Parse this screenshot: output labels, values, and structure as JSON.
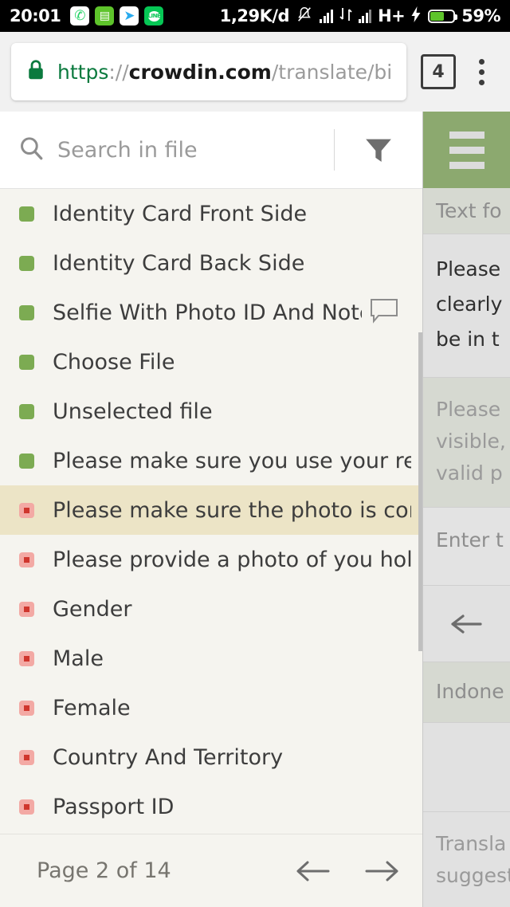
{
  "status_bar": {
    "clock": "20:01",
    "app_icons": [
      {
        "name": "whatsapp-icon",
        "glyph": "✆"
      },
      {
        "name": "battery-app-icon",
        "glyph": "▤"
      },
      {
        "name": "telegram-icon",
        "glyph": "➤"
      },
      {
        "name": "line-icon",
        "glyph": "LINE"
      }
    ],
    "network_speed": "1,29K/d",
    "network_type": "H+",
    "battery_percent": "59%",
    "battery_level": 59,
    "icons": {
      "silent": "bell-slash-icon",
      "signal_1": "signal-bars-icon",
      "data_transfer": "data-transfer-icon",
      "signal_2": "signal-bars-icon",
      "charging": "charging-bolt-icon",
      "battery": "battery-icon"
    }
  },
  "browser": {
    "lock_icon": "lock-icon",
    "url": {
      "scheme": "https",
      "separator": "://",
      "host": "crowdin.com",
      "path": "/translate/bina"
    },
    "tab_count": "4",
    "overflow_menu": "more-vertical-icon"
  },
  "sidebar": {
    "search": {
      "icon": "search-icon",
      "placeholder": "Search in file",
      "value": ""
    },
    "filter_icon": "filter-funnel-icon",
    "strings": [
      {
        "label": "Identity Card Front Side",
        "status": "translated",
        "has_comment": false,
        "selected": false
      },
      {
        "label": "Identity Card Back Side",
        "status": "translated",
        "has_comment": false,
        "selected": false
      },
      {
        "label": "Selfie With Photo ID And Note",
        "status": "translated",
        "has_comment": true,
        "selected": false
      },
      {
        "label": "Choose File",
        "status": "translated",
        "has_comment": false,
        "selected": false
      },
      {
        "label": "Unselected file",
        "status": "translated",
        "has_comment": false,
        "selected": false
      },
      {
        "label": "Please make sure you use your real ide…",
        "status": "translated",
        "has_comment": false,
        "selected": false
      },
      {
        "label": "Please make sure the photo is complet…",
        "status": "untranslated",
        "has_comment": false,
        "selected": true
      },
      {
        "label": "Please provide a photo of you holding y…",
        "status": "untranslated",
        "has_comment": false,
        "selected": false
      },
      {
        "label": "Gender",
        "status": "untranslated",
        "has_comment": false,
        "selected": false
      },
      {
        "label": "Male",
        "status": "untranslated",
        "has_comment": false,
        "selected": false
      },
      {
        "label": "Female",
        "status": "untranslated",
        "has_comment": false,
        "selected": false
      },
      {
        "label": "Country And Territory",
        "status": "untranslated",
        "has_comment": false,
        "selected": false
      },
      {
        "label": "Passport ID",
        "status": "untranslated",
        "has_comment": false,
        "selected": false
      }
    ],
    "pager": {
      "indicator": "Page 2 of 14",
      "prev_icon": "arrow-left-icon",
      "next_icon": "arrow-right-icon"
    }
  },
  "editor": {
    "hamburger_icon": "hamburger-menu-icon",
    "section_label": "Text fo",
    "source_text": "Please clearly be in t",
    "source_lines": [
      "Please",
      "clearly",
      "be in t"
    ],
    "context_lines": [
      "Please",
      "visible,",
      "valid p"
    ],
    "input_placeholder": "Enter t",
    "back_icon": "arrow-left-icon",
    "language": "Indone",
    "suggestions_lines": [
      "Transla",
      "suggest"
    ]
  },
  "colors": {
    "brand_green": "#8ca96f",
    "translated_marker": "#7cab52",
    "untranslated_marker": "#f3a9a4",
    "untranslated_dot": "#cf362d",
    "selected_row": "#ece4c6",
    "sidebar_bg": "#f5f4ef",
    "https_green": "#0b7a3e"
  }
}
